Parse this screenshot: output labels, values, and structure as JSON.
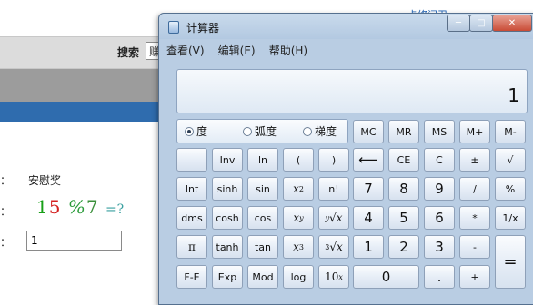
{
  "background": {
    "top_link": "卡修问卫",
    "search_label": "搜索",
    "search_value": "赚",
    "row_labels": [
      "：",
      "：",
      "："
    ],
    "prize": "安慰奖",
    "captcha": [
      "1",
      "5",
      "%",
      "7",
      "=?"
    ],
    "answer_value": "1"
  },
  "window": {
    "title": "计算器",
    "controls": {
      "minimize": "─",
      "maximize": "□",
      "close": "✕"
    }
  },
  "menu": [
    "查看(V)",
    "编辑(E)",
    "帮助(H)"
  ],
  "display": {
    "value": "1"
  },
  "angle_modes": {
    "options": [
      "度",
      "弧度",
      "梯度"
    ],
    "selected": "度"
  },
  "buttons": {
    "mc": "MC",
    "mr": "MR",
    "ms": "MS",
    "mplus": "M+",
    "mminus": "M-",
    "inv": "Inv",
    "ln": "ln",
    "lparen": "(",
    "rparen": ")",
    "back": "⟵",
    "ce": "CE",
    "c": "C",
    "plusminus": "±",
    "sqrt": "√",
    "int": "Int",
    "sinh": "sinh",
    "sin": "sin",
    "nfact": "n!",
    "seven": "7",
    "eight": "8",
    "nine": "9",
    "div": "/",
    "pct": "%",
    "dms": "dms",
    "cosh": "cosh",
    "cos": "cos",
    "four": "4",
    "five": "5",
    "six": "6",
    "mul": "*",
    "recip": "1/x",
    "pi": "π",
    "tanh": "tanh",
    "tan": "tan",
    "one": "1",
    "two": "2",
    "three": "3",
    "minus": "-",
    "fe": "F-E",
    "exp": "Exp",
    "mod": "Mod",
    "log": "log",
    "zero": "0",
    "dot": ".",
    "plus": "+",
    "equals": "="
  },
  "icons": {
    "app": "calculator-icon"
  }
}
